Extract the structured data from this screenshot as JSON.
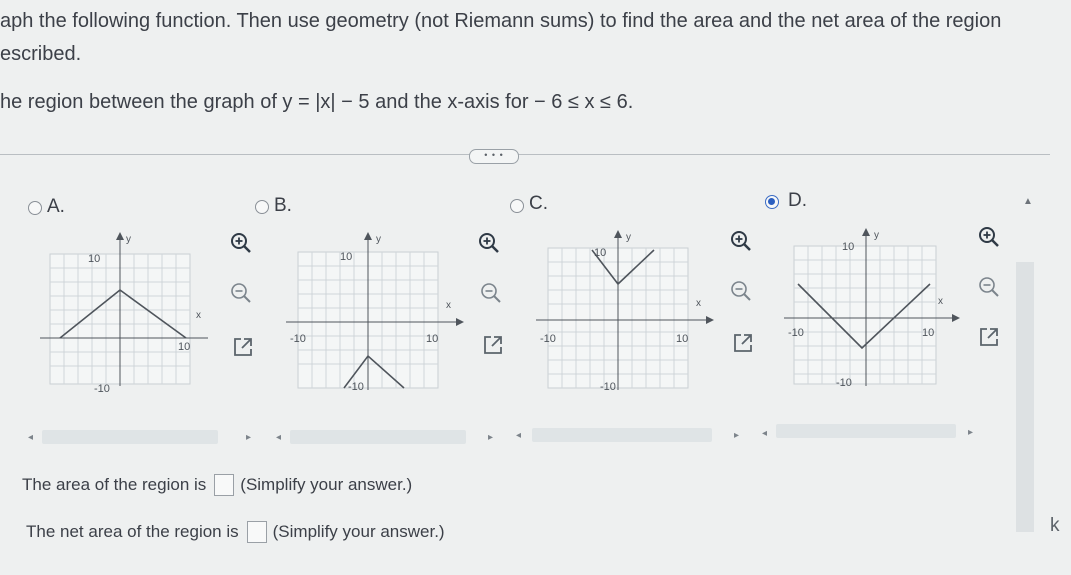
{
  "prompt": {
    "line1": "aph the following function. Then use geometry (not Riemann sums) to find the area and the net area of the region",
    "line2": "escribed.",
    "line3": "he region between the graph of y = |x| − 5 and the x-axis for  − 6 ≤ x ≤ 6."
  },
  "more_button": "• • •",
  "options": [
    {
      "label": "A.",
      "selected": false
    },
    {
      "label": "B.",
      "selected": false
    },
    {
      "label": "C.",
      "selected": false
    },
    {
      "label": "D.",
      "selected": true
    }
  ],
  "graph_labels": {
    "y": "y",
    "x": "x",
    "ten": "10",
    "neg_ten": "-10"
  },
  "answers": {
    "area_label": "The area of the region is",
    "area_hint": "(Simplify your answer.)",
    "net_label": "The net area of the region is",
    "net_hint": "(Simplify your answer.)"
  },
  "ok_fragment": "k",
  "icons": [
    "zoom-in-icon",
    "zoom-out-icon",
    "popout-icon"
  ],
  "colors": {
    "accent": "#2b5fc0",
    "grid": "#c9cfd3",
    "curve": "#4f555c"
  }
}
